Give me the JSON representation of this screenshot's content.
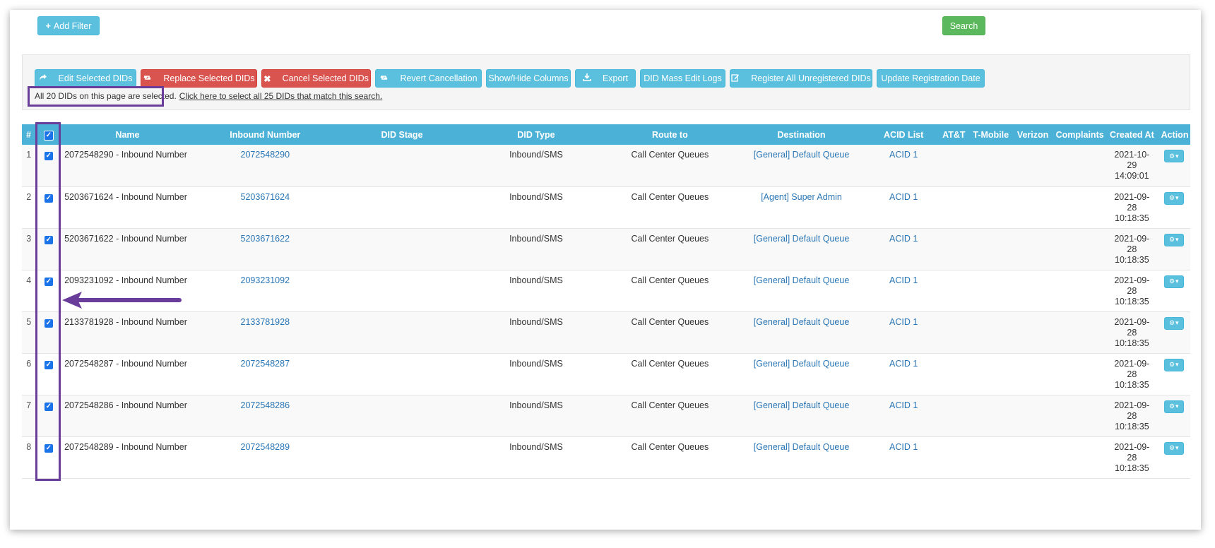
{
  "top_bar": {
    "add_filter_label": "Add Filter",
    "search_label": "Search"
  },
  "toolbar": {
    "buttons": [
      {
        "label": "Edit Selected DIDs",
        "icon": "share-icon",
        "style": "info"
      },
      {
        "label": "Replace Selected DIDs",
        "icon": "retweet-icon",
        "style": "danger"
      },
      {
        "label": "Cancel Selected DIDs",
        "icon": "close-icon",
        "style": "danger"
      },
      {
        "label": "Revert Cancellation",
        "icon": "retweet-icon",
        "style": "info"
      },
      {
        "label": "Show/Hide Columns",
        "icon": "",
        "style": "info"
      },
      {
        "label": "Export",
        "icon": "download-icon",
        "style": "info"
      },
      {
        "label": "DID Mass Edit Logs",
        "icon": "",
        "style": "info"
      },
      {
        "label": "Register All Unregistered DIDs",
        "icon": "edit-icon",
        "style": "info"
      },
      {
        "label": "Update Registration Date",
        "icon": "",
        "style": "info"
      }
    ]
  },
  "selection": {
    "selected_text": "All 20 DIDs on this page are selected.",
    "select_all_link": "Click here to select all 25 DIDs that match this search."
  },
  "table": {
    "headers": {
      "num": "#",
      "name": "Name",
      "inbound": "Inbound Number",
      "stage": "DID Stage",
      "type": "DID Type",
      "route": "Route to",
      "destination": "Destination",
      "acid": "ACID List",
      "att": "AT&T",
      "tmobile": "T-Mobile",
      "verizon": "Verizon",
      "complaints": "Complaints",
      "created": "Created At",
      "action": "Action"
    },
    "rows": [
      {
        "num": "1",
        "name": "2072548290 - Inbound Number",
        "inbound": "2072548290",
        "stage": "",
        "type": "Inbound/SMS",
        "route": "Call Center Queues",
        "destination": "[General] Default Queue",
        "acid": "ACID 1",
        "created_date": "2021-10-",
        "created_day": "29",
        "created_time": "14:09:01"
      },
      {
        "num": "2",
        "name": "5203671624 - Inbound Number",
        "inbound": "5203671624",
        "stage": "",
        "type": "Inbound/SMS",
        "route": "Call Center Queues",
        "destination": "[Agent] Super Admin",
        "acid": "ACID 1",
        "created_date": "2021-09-",
        "created_day": "28",
        "created_time": "10:18:35"
      },
      {
        "num": "3",
        "name": "5203671622 - Inbound Number",
        "inbound": "5203671622",
        "stage": "",
        "type": "Inbound/SMS",
        "route": "Call Center Queues",
        "destination": "[General] Default Queue",
        "acid": "ACID 1",
        "created_date": "2021-09-",
        "created_day": "28",
        "created_time": "10:18:35"
      },
      {
        "num": "4",
        "name": "2093231092 - Inbound Number",
        "inbound": "2093231092",
        "stage": "",
        "type": "Inbound/SMS",
        "route": "Call Center Queues",
        "destination": "[General] Default Queue",
        "acid": "ACID 1",
        "created_date": "2021-09-",
        "created_day": "28",
        "created_time": "10:18:35"
      },
      {
        "num": "5",
        "name": "2133781928 - Inbound Number",
        "inbound": "2133781928",
        "stage": "",
        "type": "Inbound/SMS",
        "route": "Call Center Queues",
        "destination": "[General] Default Queue",
        "acid": "ACID 1",
        "created_date": "2021-09-",
        "created_day": "28",
        "created_time": "10:18:35"
      },
      {
        "num": "6",
        "name": "2072548287 - Inbound Number",
        "inbound": "2072548287",
        "stage": "",
        "type": "Inbound/SMS",
        "route": "Call Center Queues",
        "destination": "[General] Default Queue",
        "acid": "ACID 1",
        "created_date": "2021-09-",
        "created_day": "28",
        "created_time": "10:18:35"
      },
      {
        "num": "7",
        "name": "2072548286 - Inbound Number",
        "inbound": "2072548286",
        "stage": "",
        "type": "Inbound/SMS",
        "route": "Call Center Queues",
        "destination": "[General] Default Queue",
        "acid": "ACID 1",
        "created_date": "2021-09-",
        "created_day": "28",
        "created_time": "10:18:35"
      },
      {
        "num": "8",
        "name": "2072548289 - Inbound Number",
        "inbound": "2072548289",
        "stage": "",
        "type": "Inbound/SMS",
        "route": "Call Center Queues",
        "destination": "[General] Default Queue",
        "acid": "ACID 1",
        "created_date": "2021-09-",
        "created_day": "28",
        "created_time": "10:18:35"
      }
    ]
  },
  "colors": {
    "header_bg": "#4cb1d6",
    "info": "#5bc0de",
    "danger": "#d9534f",
    "success": "#5cb85c",
    "link": "#2a76b5",
    "annotation": "#6a3d9a"
  }
}
